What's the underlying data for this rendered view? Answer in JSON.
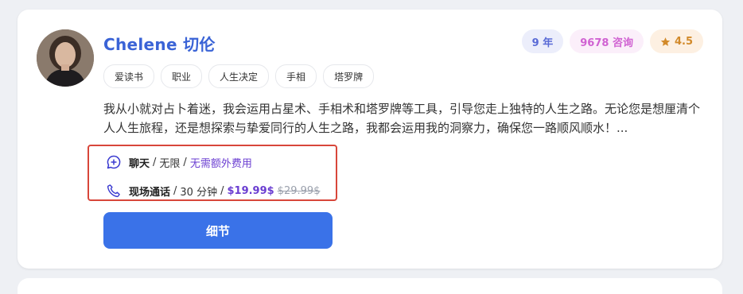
{
  "advisor": {
    "name": "Chelene  切伦",
    "badges": {
      "years": "9 年",
      "consultations": "9678 咨询",
      "rating": "4.5"
    },
    "tags": [
      "爱读书",
      "职业",
      "人生决定",
      "手相",
      "塔罗牌"
    ],
    "description": "我从小就对占卜着迷，我会运用占星术、手相术和塔罗牌等工具，引导您走上独特的人生之路。无论您是想厘清个人人生旅程，还是想探索与挚爱同行的人生之路，我都会运用我的洞察力，确保您一路顺风顺水！..."
  },
  "pricing": {
    "chat": {
      "label": "聊天",
      "duration": "无限",
      "note": "无需额外费用"
    },
    "call": {
      "label": "现场通话",
      "duration": "30 分钟",
      "price": "$19.99$",
      "old_price": "$29.99$"
    },
    "separator": "/"
  },
  "actions": {
    "details_label": "细节"
  },
  "colors": {
    "name": "#3a63d6",
    "accent_purple": "#6a3dd1",
    "button": "#3a72e8",
    "highlight_box": "#d8463a"
  },
  "icons": {
    "chat": "chat-bubble-plus-icon",
    "call": "phone-icon",
    "rating": "star-icon"
  }
}
